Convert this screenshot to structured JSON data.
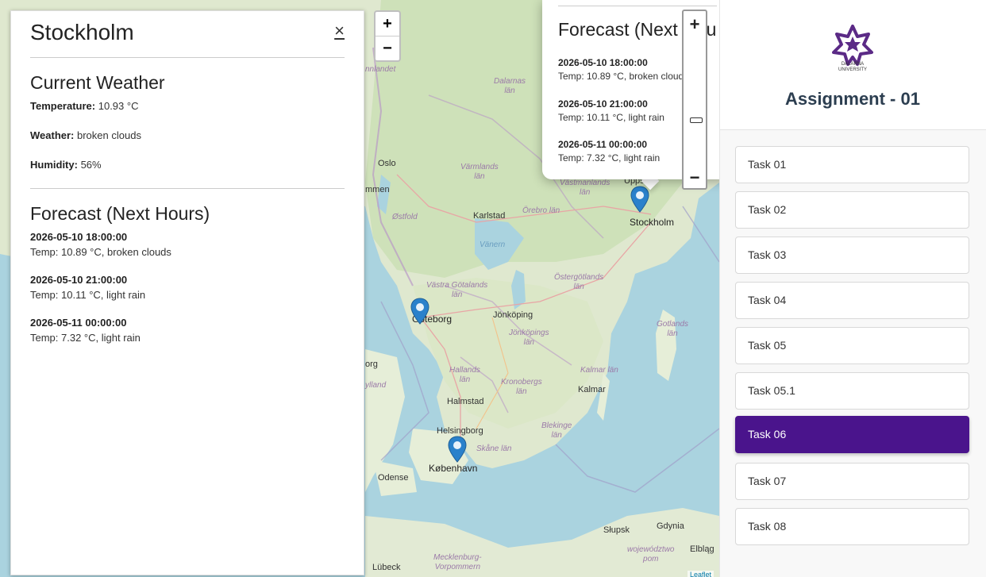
{
  "map": {
    "zoom_in": "+",
    "zoom_out": "−",
    "labels": {
      "oslo": "Oslo",
      "stockholm": "Stockholm",
      "goteborg": "Göteborg",
      "karlstad": "Karlstad",
      "jonkoping": "Jönköping",
      "kalmar": "Kalmar",
      "halmstad": "Halmstad",
      "helsingborg": "Helsingborg",
      "kobenhavn": "København",
      "odense": "Odense",
      "lubeck": "Lübeck",
      "slupsk": "Słupsk",
      "gdynia": "Gdynia",
      "elblag": "Elbląg",
      "uppsala": "Uppsa",
      "vanern": "Vänern",
      "ostfold": "Østfold",
      "dalarnas": "Dalarnas\nlän",
      "varmlands": "Värmlands\nlän",
      "orebro": "Örebro län",
      "vastmanlands": "Västmanlands\nlän",
      "vastra_gotaland": "Västra Götalands\nlän",
      "ostergotlands": "Östergötlands\nlän",
      "jonkopings": "Jönköpings\nlän",
      "hallands": "Hallands\nlän",
      "kronobergs": "Kronobergs\nlän",
      "kalmar_lan": "Kalmar län",
      "blekinge": "Blekinge\nlän",
      "skane": "Skåne län",
      "gotlands": "Gotlands\nlän",
      "innlandet": "nnlandet",
      "mmen": "mmen",
      "org": "org",
      "ylland": "ylland",
      "mecklenburg": "Mecklenburg-\nVorpommern",
      "wojewodztwo": "województwo\npom",
      "attribution": "Leaflet"
    }
  },
  "side_panel": {
    "city": "Stockholm",
    "close": "×",
    "current_heading": "Current Weather",
    "temperature_label": "Temperature:",
    "temperature_value": " 10.93 °C",
    "weather_label": "Weather:",
    "weather_value": " broken clouds",
    "humidity_label": "Humidity:",
    "humidity_value": " 56%",
    "forecast_heading": "Forecast (Next Hours)",
    "forecast": [
      {
        "datetime": "2026-05-10 18:00:00",
        "summary": "Temp: 10.89 °C, broken clouds"
      },
      {
        "datetime": "2026-05-10 21:00:00",
        "summary": "Temp: 10.11 °C, light rain"
      },
      {
        "datetime": "2026-05-11 00:00:00",
        "summary": "Temp: 7.32 °C, light rain"
      }
    ]
  },
  "popup": {
    "heading": "Forecast (Next Hou",
    "forecast": [
      {
        "datetime": "2026-05-10 18:00:00",
        "summary": "Temp: 10.89 °C, broken clouds"
      },
      {
        "datetime": "2026-05-10 21:00:00",
        "summary": "Temp: 10.11 °C, light rain"
      },
      {
        "datetime": "2026-05-11 00:00:00",
        "summary": "Temp: 7.32 °C, light rain"
      }
    ]
  },
  "vertical_zoom": {
    "plus": "+",
    "minus": "−"
  },
  "sidebar": {
    "logo_text_line1": "DALARNA",
    "logo_text_line2": "UNIVERSITY",
    "title": "Assignment - 01",
    "accent": "#4a148c",
    "tasks": [
      {
        "label": "Task 01"
      },
      {
        "label": "Task 02"
      },
      {
        "label": "Task 03"
      },
      {
        "label": "Task 04"
      },
      {
        "label": "Task 05"
      },
      {
        "label": "Task 05.1"
      },
      {
        "label": "Task 06",
        "active": true
      },
      {
        "label": "Task 07"
      },
      {
        "label": "Task 08"
      }
    ]
  }
}
